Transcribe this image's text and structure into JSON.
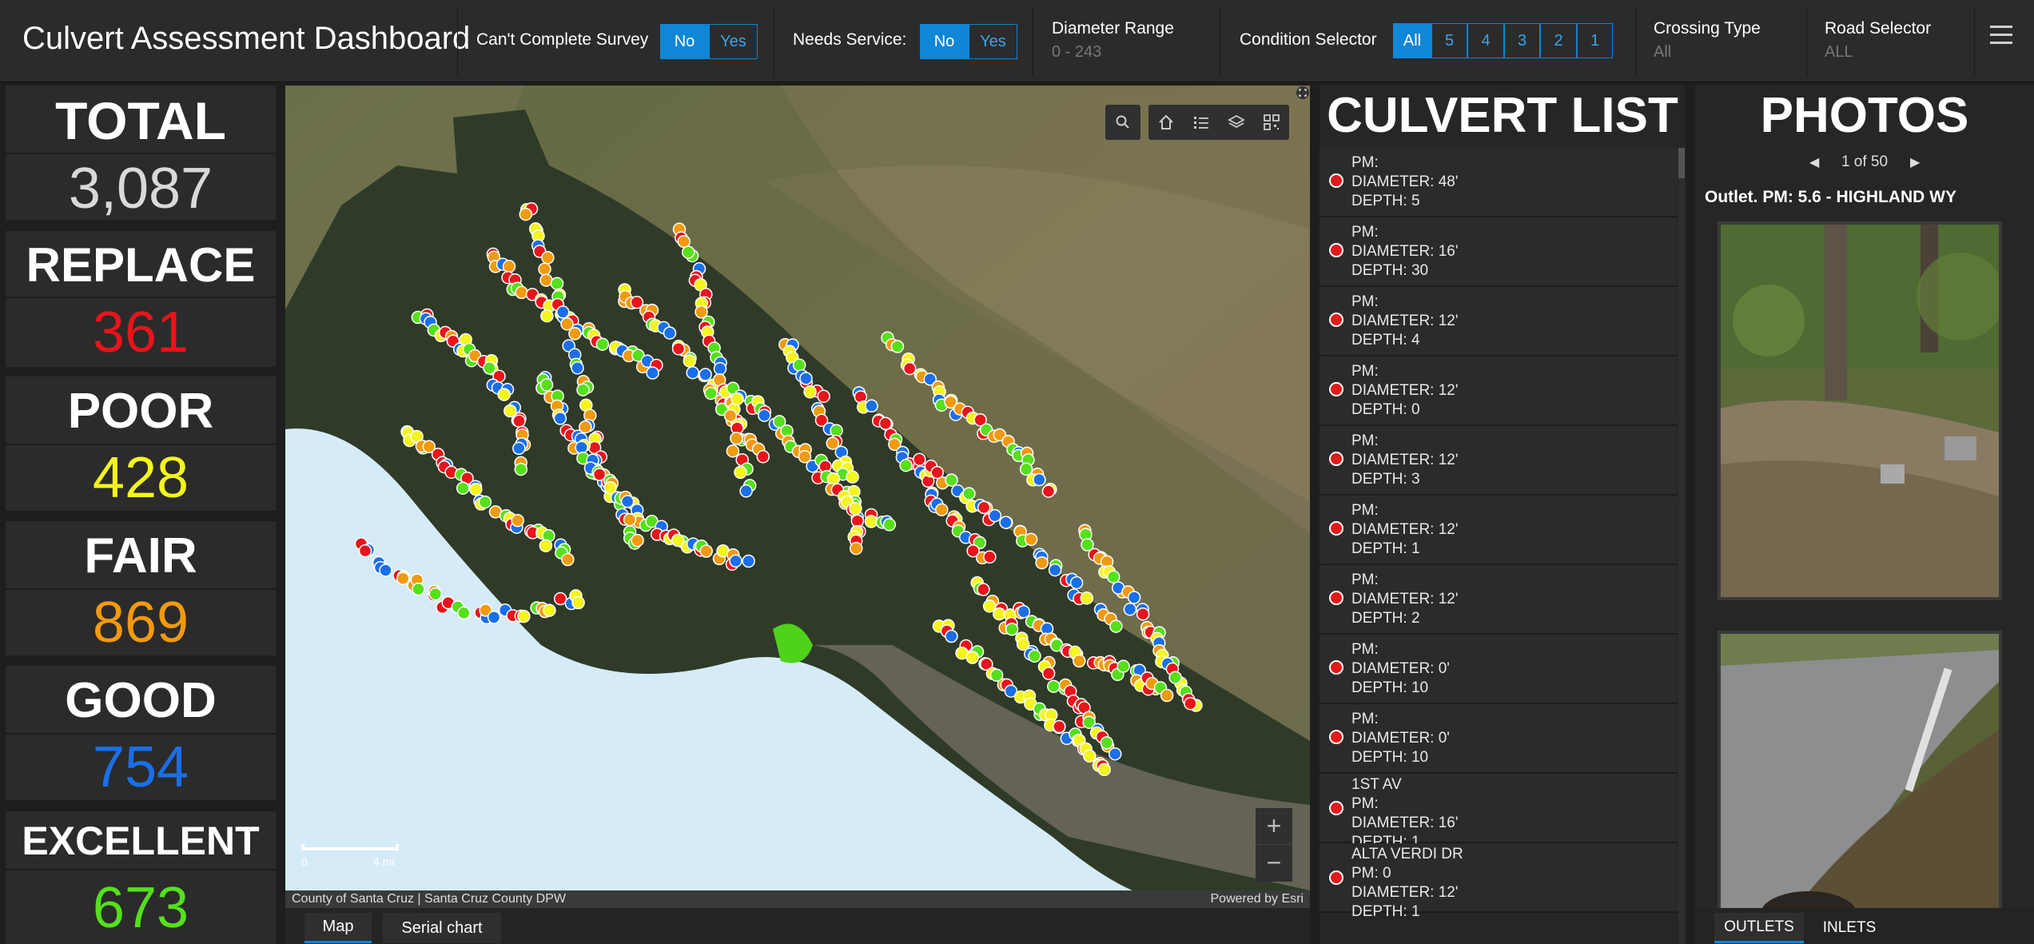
{
  "header": {
    "title": "Culvert Assessment Dashboard",
    "cant_complete": {
      "label": "Can't Complete Survey",
      "options": [
        "No",
        "Yes"
      ],
      "selected": "No"
    },
    "needs_service": {
      "label": "Needs Service:",
      "options": [
        "No",
        "Yes"
      ],
      "selected": "No"
    },
    "diameter": {
      "label": "Diameter Range",
      "value": "0 - 243"
    },
    "condition": {
      "label": "Condition Selector",
      "options": [
        "All",
        "5",
        "4",
        "3",
        "2",
        "1"
      ],
      "selected": "All"
    },
    "crossing": {
      "label": "Crossing Type",
      "value": "All"
    },
    "road": {
      "label": "Road Selector",
      "value": "ALL"
    },
    "menu_icon": "hamburger-menu-icon"
  },
  "stats": [
    {
      "label": "TOTAL",
      "value": "3,087",
      "color": "#d9d9d9"
    },
    {
      "label": "REPLACE",
      "value": "361",
      "color": "#e8141b"
    },
    {
      "label": "POOR",
      "value": "428",
      "color": "#f5f51c"
    },
    {
      "label": "FAIR",
      "value": "869",
      "color": "#f19a0f"
    },
    {
      "label": "GOOD",
      "value": "754",
      "color": "#1a6fe8"
    },
    {
      "label": "EXCELLENT",
      "value": "673",
      "color": "#55e01b"
    }
  ],
  "map": {
    "tools": [
      "search-icon",
      "home-icon",
      "legend-list-icon",
      "layers-icon",
      "qr-code-icon"
    ],
    "fullscreen_icon": "expand-icon",
    "zoom_in": "+",
    "zoom_out": "−",
    "scale_start": "0",
    "scale_end": "4 mi",
    "attribution_left": "County of Santa Cruz | Santa Cruz County DPW",
    "attribution_right": "Powered by Esri",
    "point_colors": [
      "#e8141b",
      "#f5f51c",
      "#f19a0f",
      "#1a6fe8",
      "#55e01b"
    ]
  },
  "bottom_tabs": {
    "map": "Map",
    "serial": "Serial chart"
  },
  "culvert_list": {
    "title": "CULVERT LIST",
    "items": [
      {
        "road": "",
        "pm": "PM:",
        "diameter": "DIAMETER: 48'",
        "depth": "DEPTH: 5"
      },
      {
        "road": "",
        "pm": "PM:",
        "diameter": "DIAMETER: 16'",
        "depth": "DEPTH: 30"
      },
      {
        "road": "",
        "pm": "PM:",
        "diameter": "DIAMETER: 12'",
        "depth": "DEPTH: 4"
      },
      {
        "road": "",
        "pm": "PM:",
        "diameter": "DIAMETER: 12'",
        "depth": "DEPTH: 0"
      },
      {
        "road": "",
        "pm": "PM:",
        "diameter": "DIAMETER: 12'",
        "depth": "DEPTH: 3"
      },
      {
        "road": "",
        "pm": "PM:",
        "diameter": "DIAMETER: 12'",
        "depth": "DEPTH: 1"
      },
      {
        "road": "",
        "pm": "PM:",
        "diameter": "DIAMETER: 12'",
        "depth": "DEPTH: 2"
      },
      {
        "road": "",
        "pm": "PM:",
        "diameter": "DIAMETER: 0'",
        "depth": "DEPTH: 10"
      },
      {
        "road": "",
        "pm": "PM:",
        "diameter": "DIAMETER: 0'",
        "depth": "DEPTH: 10"
      },
      {
        "road": "1ST AV",
        "pm": "PM:",
        "diameter": "DIAMETER: 16'",
        "depth": "DEPTH: 1"
      },
      {
        "road": "ALTA VERDI DR",
        "pm": "PM: 0",
        "diameter": "DIAMETER: 12'",
        "depth": "DEPTH: 1"
      }
    ]
  },
  "photos": {
    "title": "PHOTOS",
    "pager": "1 of 50",
    "caption": "Outlet. PM: 5.6 - HIGHLAND WY",
    "tabs": [
      "OUTLETS",
      "INLETS"
    ],
    "selected_tab": "OUTLETS"
  }
}
